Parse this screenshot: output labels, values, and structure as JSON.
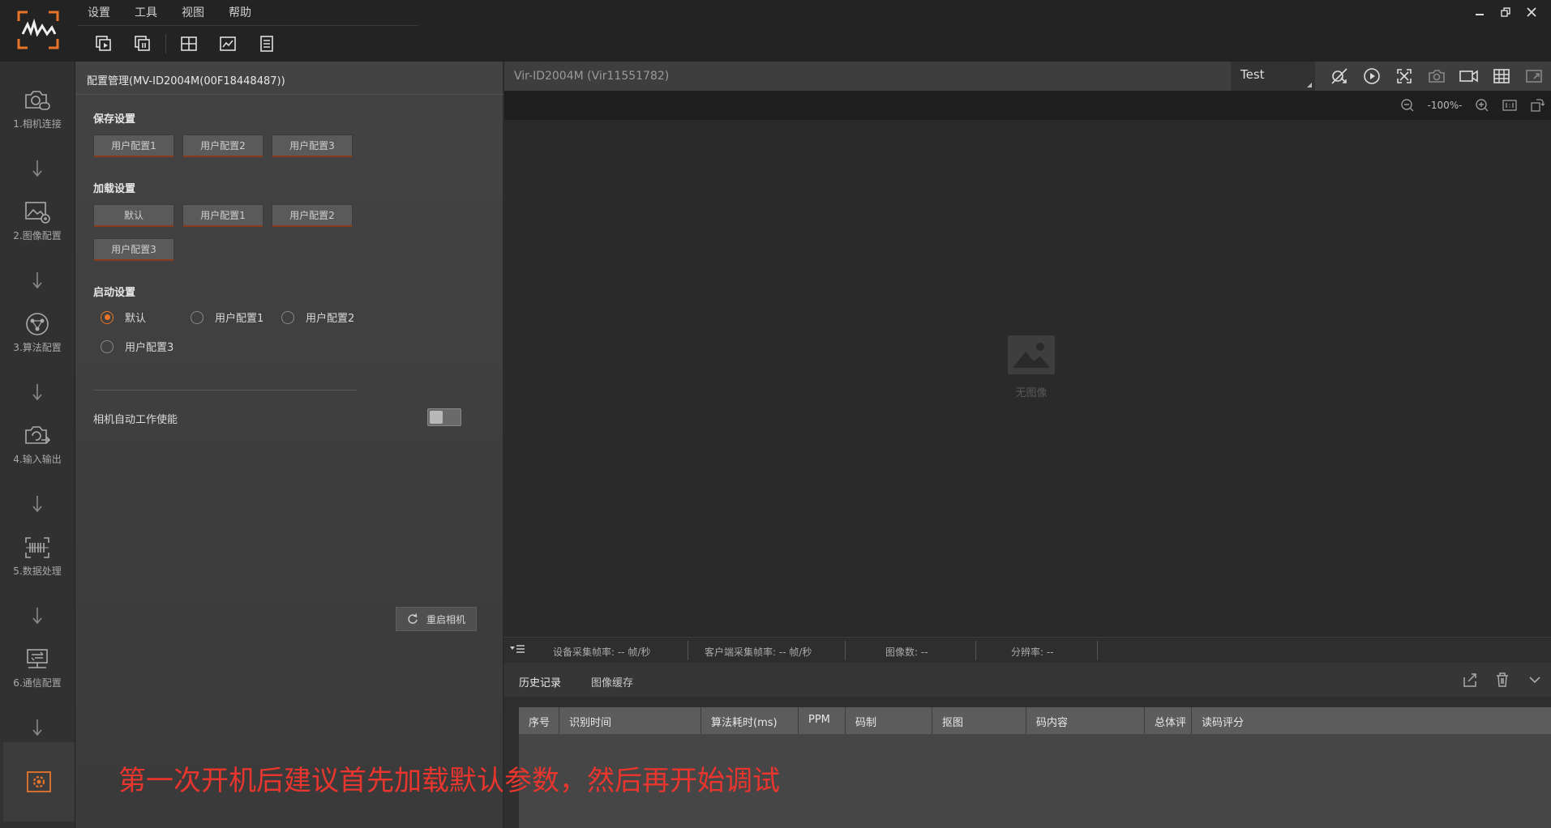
{
  "menu": [
    "设置",
    "工具",
    "视图",
    "帮助"
  ],
  "nav": [
    {
      "label": "1.相机连接",
      "icon": "camera-link-icon"
    },
    {
      "label": "2.图像配置",
      "icon": "image-settings-icon"
    },
    {
      "label": "3.算法配置",
      "icon": "algorithm-icon"
    },
    {
      "label": "4.输入输出",
      "icon": "io-camera-icon"
    },
    {
      "label": "5.数据处理",
      "icon": "barcode-scan-icon"
    },
    {
      "label": "6.通信配置",
      "icon": "network-icon"
    }
  ],
  "panel": {
    "title": "配置管理(MV-ID2004M(00F18448487))",
    "save_section": "保存设置",
    "save_buttons": [
      "用户配置1",
      "用户配置2",
      "用户配置3"
    ],
    "load_section": "加载设置",
    "load_buttons": [
      "默认",
      "用户配置1",
      "用户配置2",
      "用户配置3"
    ],
    "startup_section": "启动设置",
    "startup_options": [
      "默认",
      "用户配置1",
      "用户配置2",
      "用户配置3"
    ],
    "startup_selected": "默认",
    "auto_work_label": "相机自动工作使能",
    "auto_work_enabled": false,
    "restart_label": "重启相机"
  },
  "overlay_note": "第一次开机后建议首先加载默认参数，然后再开始调试",
  "viewer": {
    "title": "Vir-ID2004M (Vir11551782)",
    "solution": "Test",
    "zoom": "-100%-",
    "no_image": "无图像"
  },
  "status": {
    "device_fps": "设备采集帧率: -- 帧/秒",
    "client_fps": "客户端采集帧率: -- 帧/秒",
    "image_count": "图像数: --",
    "resolution": "分辨率: --"
  },
  "tabs": [
    "历史记录",
    "图像缓存"
  ],
  "table_headers": [
    "序号",
    "识别时间",
    "算法耗时(ms)",
    "PPM",
    "码制",
    "抠图",
    "码内容",
    "总体评",
    "读码评分"
  ],
  "colors": {
    "accent": "#e8742a",
    "note": "#e8362f"
  }
}
